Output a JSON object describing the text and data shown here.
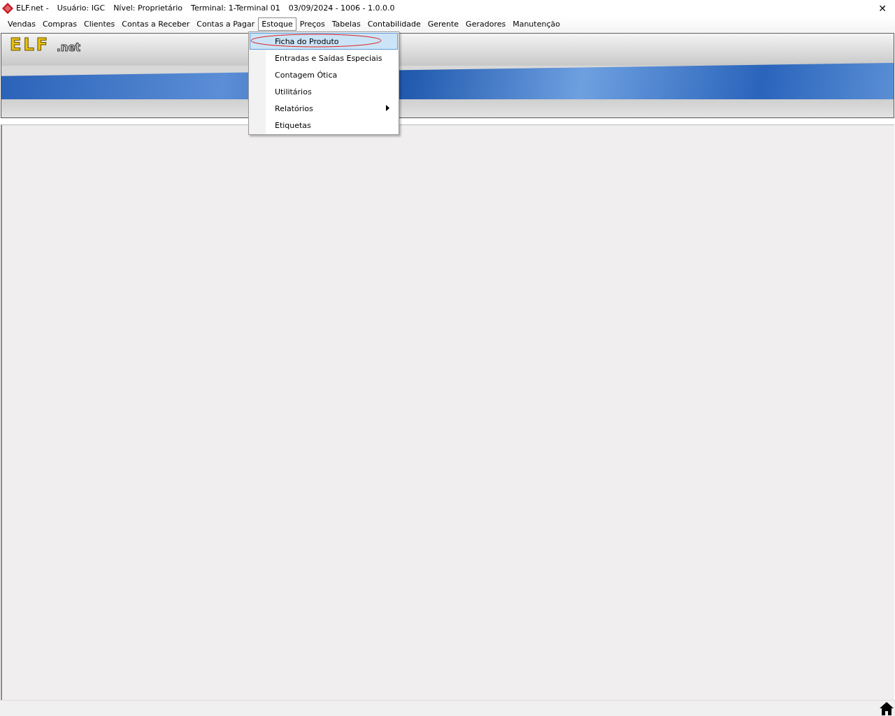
{
  "window": {
    "title_parts": [
      "ELF.net -",
      "Usuário: IGC",
      "Nível: Proprietário",
      "Terminal: 1-Terminal 01",
      "03/09/2024 - 1006 - 1.0.0.0"
    ],
    "close": "✕"
  },
  "menu": [
    {
      "label": "Vendas",
      "selected": false
    },
    {
      "label": "Compras",
      "selected": false
    },
    {
      "label": "Clientes",
      "selected": false
    },
    {
      "label": "Contas a Receber",
      "selected": false
    },
    {
      "label": "Contas a Pagar",
      "selected": false
    },
    {
      "label": "Estoque",
      "selected": true
    },
    {
      "label": "Preços",
      "selected": false
    },
    {
      "label": "Tabelas",
      "selected": false
    },
    {
      "label": "Contabilidade",
      "selected": false
    },
    {
      "label": "Gerente",
      "selected": false
    },
    {
      "label": "Geradores",
      "selected": false
    },
    {
      "label": "Manutenção",
      "selected": false
    }
  ],
  "banner": {
    "logo": "ELF",
    "logo_suffix": ".net"
  },
  "dropdown": [
    {
      "label": "Ficha do Produto",
      "selected": true,
      "submenu": false,
      "circled": true
    },
    {
      "label": "Entradas e Saídas Especiais",
      "selected": false,
      "submenu": false,
      "circled": false
    },
    {
      "label": "Contagem Ótica",
      "selected": false,
      "submenu": false,
      "circled": false
    },
    {
      "label": "Utilitários",
      "selected": false,
      "submenu": false,
      "circled": false
    },
    {
      "label": "Relatórios",
      "selected": false,
      "submenu": true,
      "circled": false
    },
    {
      "label": "Etiquetas",
      "selected": false,
      "submenu": false,
      "circled": false
    }
  ]
}
